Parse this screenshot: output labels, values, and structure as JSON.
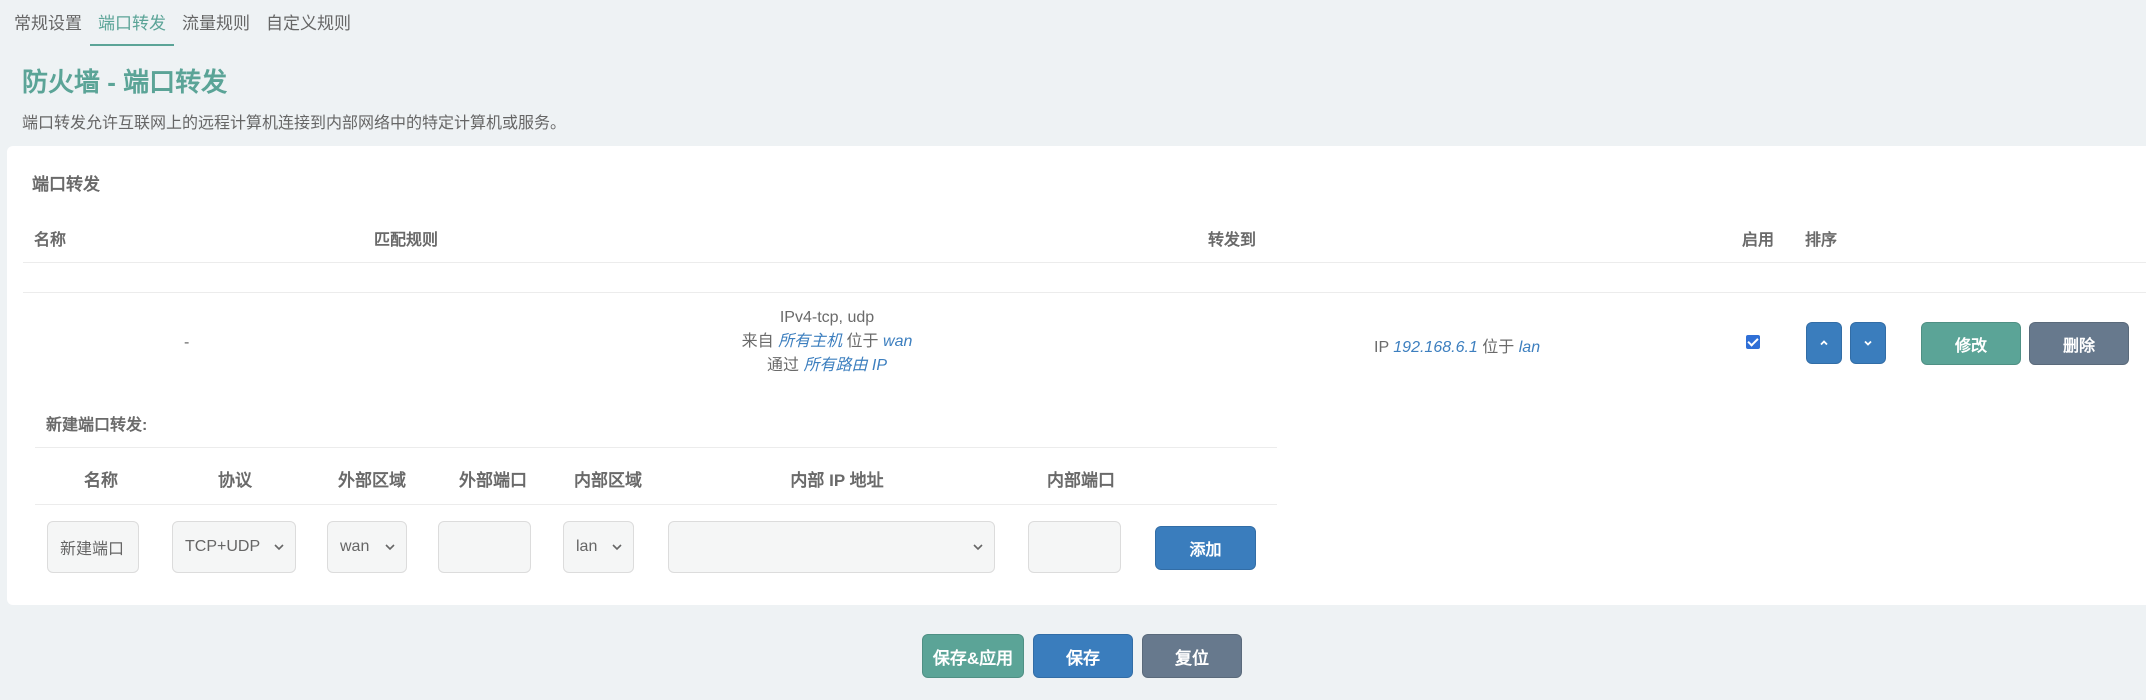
{
  "tabs": [
    {
      "label": "常规设置",
      "active": false
    },
    {
      "label": "端口转发",
      "active": true
    },
    {
      "label": "流量规则",
      "active": false
    },
    {
      "label": "自定义规则",
      "active": false
    }
  ],
  "page": {
    "title": "防火墙 - 端口转发",
    "description": "端口转发允许互联网上的远程计算机连接到内部网络中的特定计算机或服务。"
  },
  "section": {
    "title": "端口转发",
    "headers": {
      "name": "名称",
      "match": "匹配规则",
      "forward": "转发到",
      "enable": "启用",
      "sort": "排序"
    }
  },
  "rules": [
    {
      "name": "-",
      "protocol": "IPv4-tcp, udp",
      "from_prefix": "来自",
      "from_host": "所有主机",
      "from_mid": "位于",
      "from_zone": "wan",
      "via_prefix": "通过",
      "via_target": "所有路由 IP",
      "to_prefix": "IP",
      "to_ip": "192.168.6.1",
      "to_mid": "位于",
      "to_zone": "lan",
      "enabled": true,
      "edit_label": "修改",
      "delete_label": "删除"
    }
  ],
  "new_forward": {
    "title": "新建端口转发:",
    "headers": {
      "name": "名称",
      "protocol": "协议",
      "ext_zone": "外部区域",
      "ext_port": "外部端口",
      "int_zone": "内部区域",
      "int_ip": "内部 IP 地址",
      "int_port": "内部端口"
    },
    "name_placeholder": "新建端口",
    "protocol_value": "TCP+UDP",
    "ext_zone_value": "wan",
    "ext_port_value": "",
    "int_zone_value": "lan",
    "int_ip_value": "",
    "int_port_value": "",
    "add_label": "添加"
  },
  "footer": {
    "save_apply_label": "保存&应用",
    "save_label": "保存",
    "reset_label": "复位"
  },
  "colors": {
    "accent": "#5ba497",
    "primary": "#3a7dbd",
    "neutral": "#67798d",
    "link": "#3d7fbf"
  },
  "icons": {
    "sort_up": "chevron-up-icon",
    "sort_down": "chevron-down-icon",
    "dropdown": "chevron-down-icon"
  }
}
